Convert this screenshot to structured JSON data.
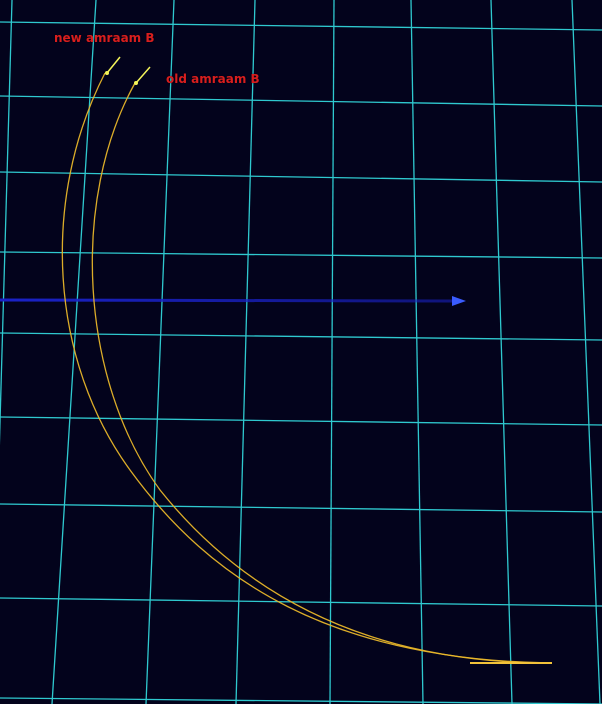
{
  "scene": {
    "background_color": "#03031c",
    "grid_color": "#2fc9cf",
    "label_color": "#d81e1e"
  },
  "missiles": [
    {
      "id": "new",
      "label": "new amraam B",
      "trail_color": "#e8b62a",
      "marker_color": "#f4f45a",
      "icon": "missile-icon"
    },
    {
      "id": "old",
      "label": "old amraam B",
      "trail_color": "#e8b62a",
      "marker_color": "#f4f45a",
      "icon": "missile-icon"
    }
  ],
  "target": {
    "track_color": "#1a22c8",
    "head_color": "#3a5cff",
    "icon": "target-arrow-icon"
  }
}
